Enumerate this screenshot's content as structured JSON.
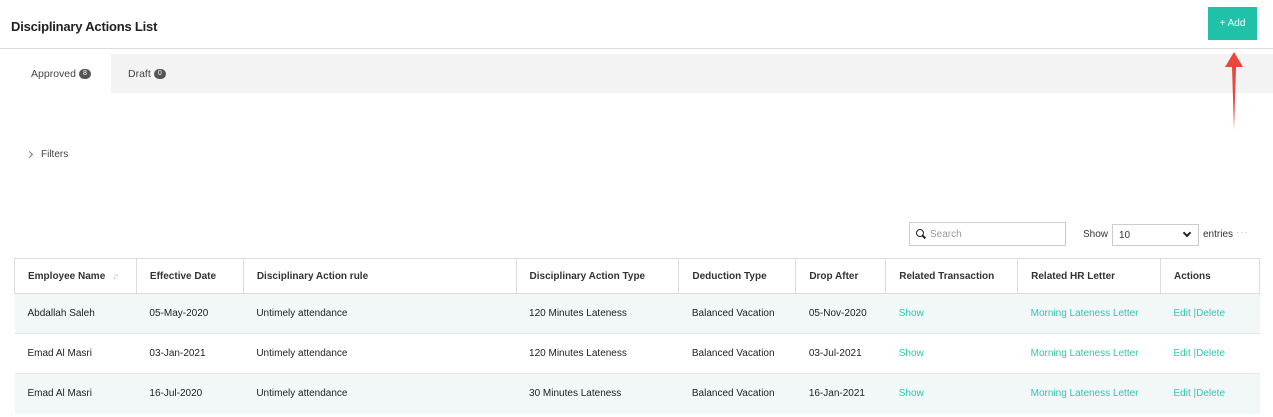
{
  "header": {
    "title": "Disciplinary Actions List",
    "add_label": "+ Add"
  },
  "tabs": [
    {
      "label": "Approved",
      "count": "8"
    },
    {
      "label": "Draft",
      "count": "0"
    }
  ],
  "filters": {
    "label": "Filters"
  },
  "search": {
    "placeholder": "Search"
  },
  "entries": {
    "show_label": "Show",
    "value": "10",
    "suffix": "entries",
    "more": "···"
  },
  "table": {
    "columns": [
      "Employee Name",
      "Effective Date",
      "Disciplinary Action rule",
      "Disciplinary Action Type",
      "Deduction Type",
      "Drop After",
      "Related Transaction",
      "Related HR Letter",
      "Actions"
    ],
    "rows": [
      {
        "employee": "Abdallah Saleh",
        "effective": "05-May-2020",
        "rule": "Untimely attendance",
        "type": "120 Minutes Lateness",
        "deduction": "Balanced Vacation",
        "drop": "05-Nov-2020",
        "transaction": "Show",
        "letter": "Morning Lateness Letter",
        "edit": "Edit",
        "delete": "|Delete"
      },
      {
        "employee": "Emad Al Masri",
        "effective": "03-Jan-2021",
        "rule": "Untimely attendance",
        "type": "120 Minutes Lateness",
        "deduction": "Balanced Vacation",
        "drop": "03-Jul-2021",
        "transaction": "Show",
        "letter": "Morning Lateness Letter",
        "edit": "Edit",
        "delete": "|Delete"
      },
      {
        "employee": "Emad Al Masri",
        "effective": "16-Jul-2020",
        "rule": "Untimely attendance",
        "type": "30 Minutes Lateness",
        "deduction": "Balanced Vacation",
        "drop": "16-Jan-2021",
        "transaction": "Show",
        "letter": "Morning Lateness Letter",
        "edit": "Edit",
        "delete": "|Delete"
      }
    ]
  },
  "colors": {
    "accent": "#1fc2a8",
    "link": "#2fc7b0",
    "annotation_arrow": "#e8473a",
    "row_stripe": "#f2f7f7"
  },
  "icons": {
    "search": "search-icon",
    "sort": "sort-icon",
    "filters": "chevron-right-icon",
    "dropdown": "chevron-down-icon"
  }
}
